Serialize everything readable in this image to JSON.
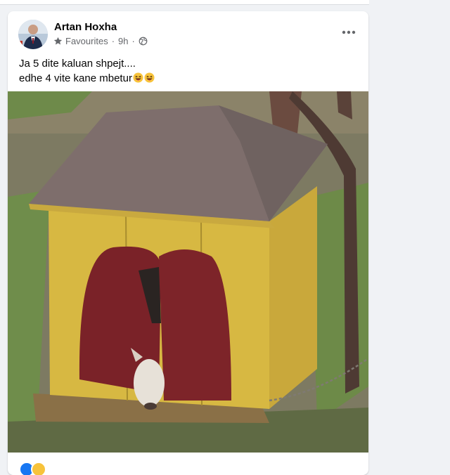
{
  "post": {
    "author": "Artan Hoxha",
    "audience": "Favourites",
    "time": "9h",
    "text_line1": "Ja 5 dite kaluan shpejt....",
    "text_line2": "edhe 4 vite kane mbetur",
    "emoji": [
      "grinning-squinting-tongue-emoji",
      "grinning-squinting-tongue-emoji"
    ]
  },
  "icons": {
    "star": "star-icon",
    "globe": "globe-icon",
    "more": "more-options-icon"
  },
  "colors": {
    "page_bg": "#f0f2f5",
    "card_bg": "#ffffff",
    "name": "#050505",
    "meta": "#65676b"
  }
}
